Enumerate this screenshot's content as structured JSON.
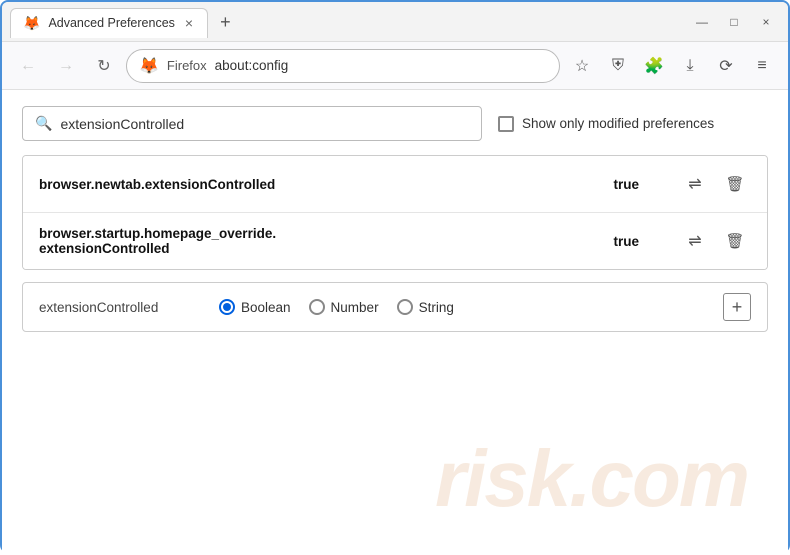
{
  "window": {
    "title": "Advanced Preferences",
    "tab_close": "×",
    "new_tab": "+",
    "minimize": "—",
    "maximize": "□",
    "close": "×"
  },
  "nav": {
    "back_label": "←",
    "forward_label": "→",
    "reload_label": "↻",
    "brand": "Firefox",
    "url": "about:config",
    "bookmark_icon": "☆",
    "shield_icon": "⛉",
    "extension_icon": "⧉",
    "download_icon": "⬇",
    "history_icon": "⟳",
    "menu_icon": "≡"
  },
  "search": {
    "placeholder": "extensionControlled",
    "value": "extensionControlled",
    "show_modified_label": "Show only modified preferences"
  },
  "preferences": [
    {
      "name": "browser.newtab.extensionControlled",
      "value": "true",
      "has_toggle": true,
      "has_delete": true
    },
    {
      "name_line1": "browser.startup.homepage_override.",
      "name_line2": "extensionControlled",
      "value": "true",
      "has_toggle": true,
      "has_delete": true
    }
  ],
  "new_pref": {
    "name": "extensionControlled",
    "type_options": [
      {
        "label": "Boolean",
        "selected": true
      },
      {
        "label": "Number",
        "selected": false
      },
      {
        "label": "String",
        "selected": false
      }
    ],
    "add_label": "+"
  },
  "watermark": "risk.com"
}
